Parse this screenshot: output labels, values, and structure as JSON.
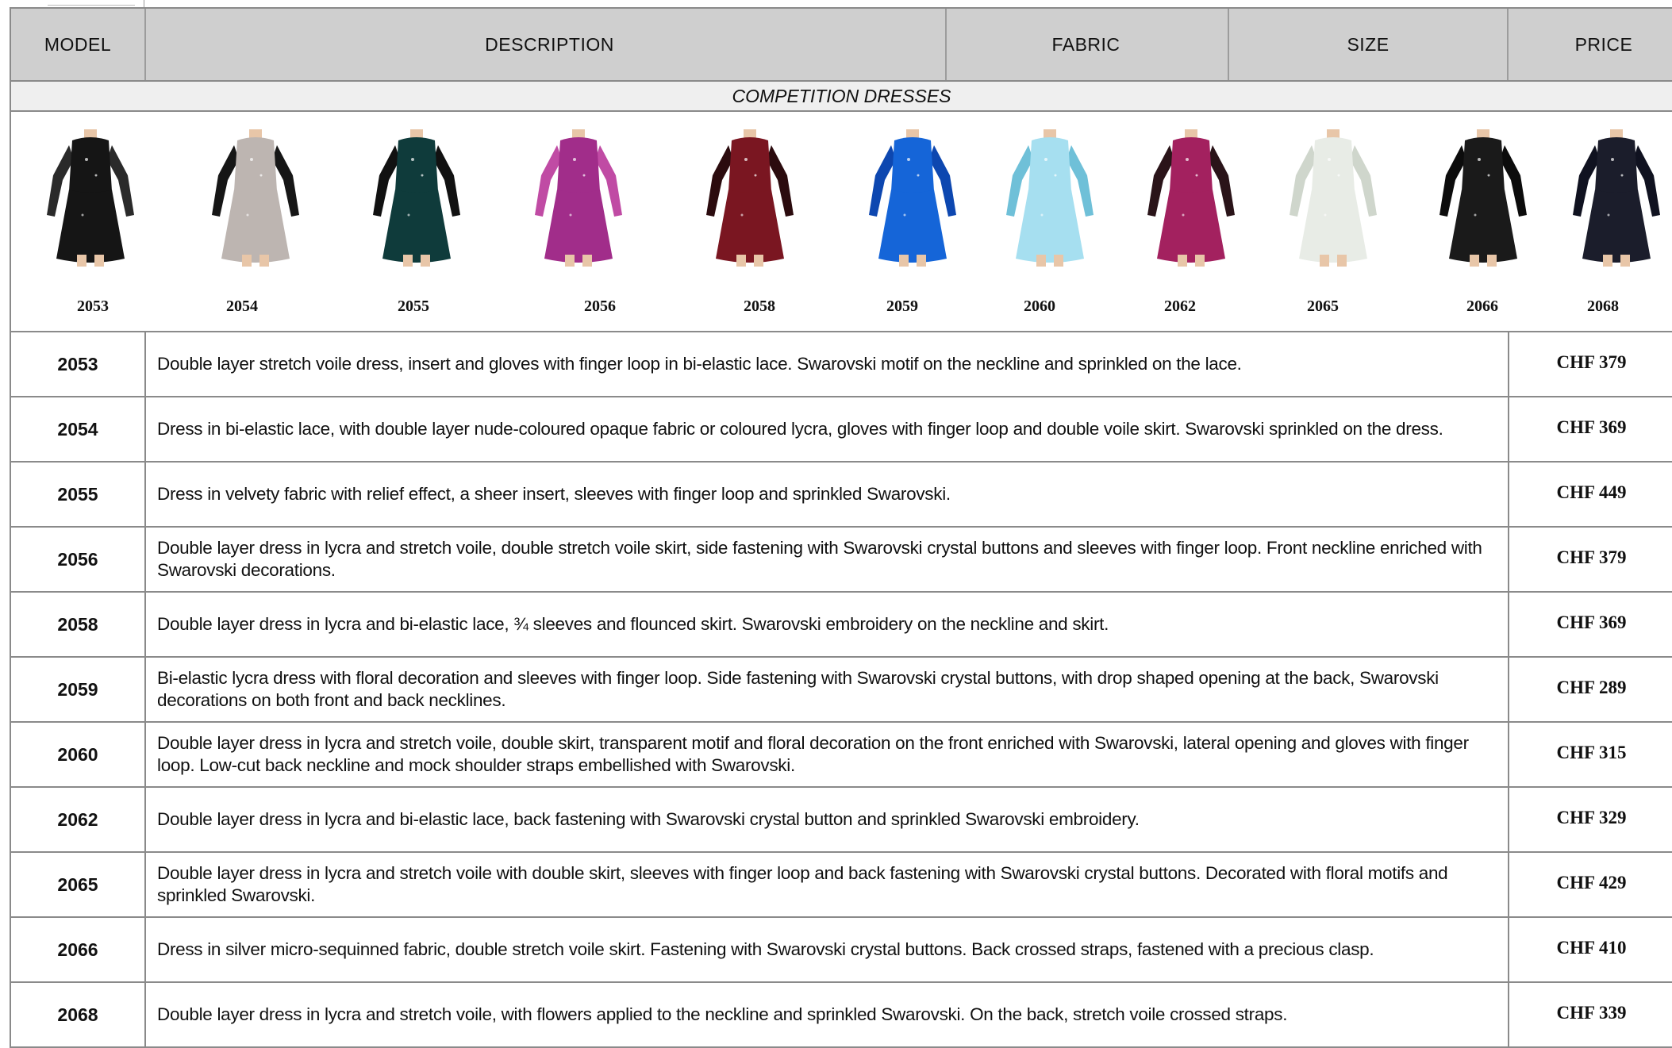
{
  "header": {
    "model": "MODEL",
    "description": "DESCRIPTION",
    "fabric": "FABRIC",
    "size": "SIZE",
    "price": "PRICE"
  },
  "section_title": "COMPETITION DRESSES",
  "gallery": [
    {
      "model": "2053",
      "colors": {
        "body": "#151515",
        "accent": "#2a2a2a",
        "skin": "#e8c6a8"
      }
    },
    {
      "model": "2054",
      "colors": {
        "body": "#bdb5b1",
        "accent": "#161616",
        "skin": "#e8c6a8"
      }
    },
    {
      "model": "2055",
      "colors": {
        "body": "#0f3b3b",
        "accent": "#111",
        "skin": "#e8c6a8"
      }
    },
    {
      "model": "2056",
      "colors": {
        "body": "#a12d8a",
        "accent": "#c04ba4",
        "skin": "#e8c6a8"
      }
    },
    {
      "model": "2058",
      "colors": {
        "body": "#7a1621",
        "accent": "#2b0b0e",
        "skin": "#e8c6a8"
      }
    },
    {
      "model": "2059",
      "colors": {
        "body": "#1565d8",
        "accent": "#0d47b0",
        "skin": "#e8c6a8"
      }
    },
    {
      "model": "2060",
      "colors": {
        "body": "#a6dff0",
        "accent": "#6fc0d8",
        "skin": "#e8c6a8"
      }
    },
    {
      "model": "2062",
      "colors": {
        "body": "#a3215f",
        "accent": "#2a1419",
        "skin": "#e8c6a8"
      }
    },
    {
      "model": "2065",
      "colors": {
        "body": "#e8ece6",
        "accent": "#cfd6cc",
        "skin": "#e8c6a8"
      }
    },
    {
      "model": "2066",
      "colors": {
        "body": "#1a1a1a",
        "accent": "#0c0c0c",
        "skin": "#e8c6a8"
      }
    },
    {
      "model": "2068",
      "colors": {
        "body": "#1b1d2b",
        "accent": "#101220",
        "skin": "#e8c6a8"
      }
    }
  ],
  "rows": [
    {
      "model": "2053",
      "description": "Double layer stretch voile dress, insert and gloves with finger loop in bi-elastic lace. Swarovski motif on the neckline and sprinkled on the lace.",
      "price": "CHF 379"
    },
    {
      "model": "2054",
      "description": "Dress in bi-elastic lace, with double layer nude-coloured opaque fabric or coloured lycra, gloves with finger loop and double voile skirt. Swarovski sprinkled on the dress.",
      "price": "CHF 369"
    },
    {
      "model": "2055",
      "description": "Dress in velvety fabric with relief effect, a sheer insert, sleeves with finger loop and sprinkled Swarovski.",
      "price": "CHF 449"
    },
    {
      "model": "2056",
      "description": "Double layer dress in lycra and stretch voile, double stretch voile skirt, side fastening with Swarovski crystal buttons and sleeves with finger loop. Front neckline enriched with Swarovski decorations.",
      "price": "CHF 379"
    },
    {
      "model": "2058",
      "description": "Double layer dress in lycra and bi-elastic lace, ¾ sleeves and flounced skirt. Swarovski embroidery on the neckline and skirt.",
      "price": "CHF 369"
    },
    {
      "model": "2059",
      "description": "Bi-elastic lycra dress with floral decoration and sleeves with finger loop. Side fastening with Swarovski crystal buttons, with drop shaped opening at the back, Swarovski decorations on both front and back necklines.",
      "price": "CHF 289"
    },
    {
      "model": "2060",
      "description": "Double layer dress in lycra and stretch voile, double skirt, transparent motif and floral decoration on the front enriched with Swarovski, lateral opening and gloves with finger loop. Low-cut back neckline and mock shoulder straps embellished with Swarovski.",
      "price": "CHF 315"
    },
    {
      "model": "2062",
      "description": "Double layer dress in lycra and bi-elastic lace, back fastening with Swarovski crystal button and sprinkled Swarovski embroidery.",
      "price": "CHF 329"
    },
    {
      "model": "2065",
      "description": "Double layer dress in lycra and stretch voile with double skirt, sleeves with finger loop and back fastening with Swarovski crystal buttons. Decorated with floral motifs and sprinkled Swarovski.",
      "price": "CHF 429"
    },
    {
      "model": "2066",
      "description": "Dress in silver micro-sequinned fabric, double stretch voile skirt. Fastening with Swarovski crystal buttons. Back crossed straps, fastened with a precious clasp.",
      "price": "CHF 410"
    },
    {
      "model": "2068",
      "description": "Double layer dress in lycra and stretch voile, with flowers applied to the neckline and sprinkled Swarovski. On the back, stretch voile crossed straps.",
      "price": "CHF 339"
    }
  ]
}
